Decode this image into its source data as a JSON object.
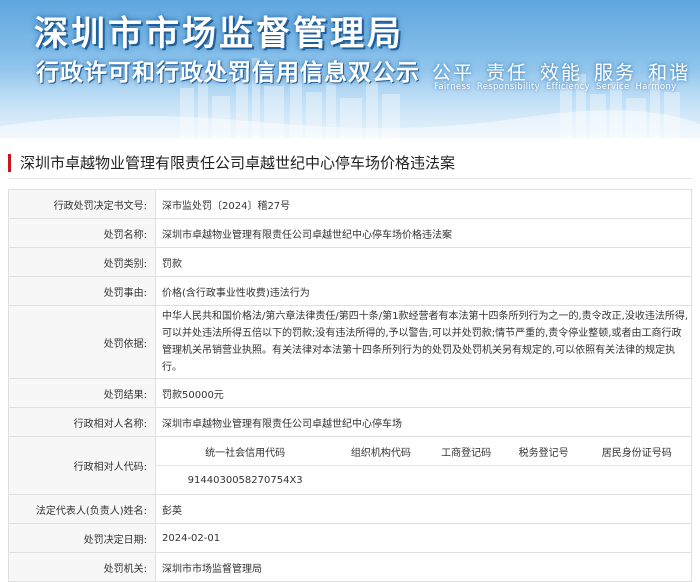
{
  "banner": {
    "title": "深圳市市场监督管理局",
    "subtitle": "行政许可和行政处罚信用信息双公示",
    "slogans_cn": [
      "公平",
      "责任",
      "效能",
      "服务",
      "和谐"
    ],
    "slogans_en": [
      "Fairness",
      "Responsibility",
      "Efficiency",
      "Service",
      "Harmony"
    ]
  },
  "case_title": "深圳市卓越物业管理有限责任公司卓越世纪中心停车场价格违法案",
  "rows": [
    {
      "label": "行政处罚决定书文号:",
      "value": "深市监处罚〔2024〕稽27号"
    },
    {
      "label": "处罚名称:",
      "value": "深圳市卓越物业管理有限责任公司卓越世纪中心停车场价格违法案"
    },
    {
      "label": "处罚类别:",
      "value": "罚款"
    },
    {
      "label": "处罚事由:",
      "value": "价格(含行政事业性收费)违法行为"
    },
    {
      "label": "处罚依据:",
      "value": "中华人民共和国价格法/第六章法律责任/第四十条/第1款经营者有本法第十四条所列行为之一的,责令改正,没收违法所得,可以并处违法所得五倍以下的罚款;没有违法所得的,予以警告,可以并处罚款;情节严重的,责令停业整顿,或者由工商行政管理机关吊销营业执照。有关法律对本法第十四条所列行为的处罚及处罚机关另有规定的,可以依照有关法律的规定执行。"
    },
    {
      "label": "处罚结果:",
      "value": "罚款50000元"
    },
    {
      "label": "行政相对人名称:",
      "value": "深圳市卓越物业管理有限责任公司卓越世纪中心停车场"
    }
  ],
  "codes": {
    "label": "行政相对人代码:",
    "headers": [
      "统一社会信用代码",
      "组织机构代码",
      "工商登记码",
      "税务登记号",
      "居民身份证号码"
    ],
    "values": [
      "9144030058270754X3",
      "",
      "",
      "",
      ""
    ]
  },
  "rows_after": [
    {
      "label": "法定代表人(负责人)姓名:",
      "value": "彭英"
    },
    {
      "label": "处罚决定日期:",
      "value": "2024-02-01"
    },
    {
      "label": "处罚机关:",
      "value": "深圳市市场监督管理局"
    }
  ]
}
